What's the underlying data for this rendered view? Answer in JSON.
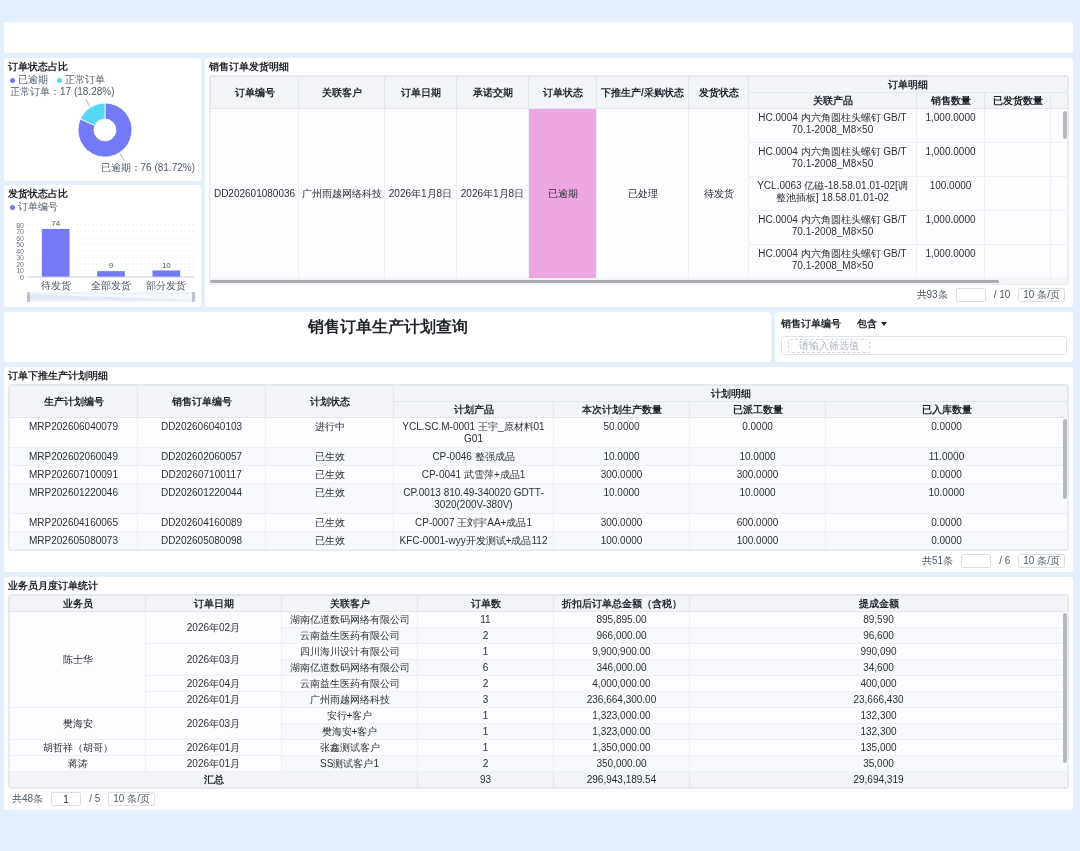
{
  "order_status_card": {
    "title": "订单状态占比",
    "legend": [
      {
        "color": "#7479f5"
      },
      {
        "color": "#55d7f6"
      }
    ],
    "chart_data": {
      "type": "donut",
      "categories": [
        "已逾期",
        "正常订单"
      ],
      "values": [
        76,
        17
      ],
      "value_labels": [
        "已逾期：76 (81.72%)",
        "正常订单：17 (18.28%)"
      ]
    }
  },
  "shipping_status_card": {
    "title": "发货状态占比",
    "chart_data": {
      "type": "bar",
      "categories": [
        "待发货",
        "全部发货",
        "部分发货"
      ],
      "series": [
        {
          "name": "订单编号",
          "color": "#7479f5",
          "values": [
            74,
            9,
            10
          ]
        }
      ],
      "ylim": [
        0,
        80
      ],
      "yticks": [
        0,
        10,
        20,
        30,
        40,
        50,
        60,
        70,
        80
      ],
      "grid": true,
      "data_labels": true
    }
  },
  "shipment_table": {
    "title": "销售订单发货明细",
    "columns": [
      "订单编号",
      "关联客户",
      "订单日期",
      "承诺交期",
      "订单状态",
      "下推生产/采购状态",
      "发货状态"
    ],
    "detail_header": "订单明细",
    "detail_columns": [
      "关联产品",
      "销售数量",
      "已发货数量"
    ],
    "rows": [
      {
        "order_no": "DD202601080036",
        "customer": "广州雨越网络科技",
        "order_date": "2026年1月8日",
        "promised_date": "2026年1月8日",
        "order_status": "已逾期",
        "overdue": true,
        "push_status": "已处理",
        "shipping_status": "待发货",
        "items": [
          {
            "product": "HC.0004 内六角圆柱头螺钉 GB/T 70.1-2008_M8×50",
            "quantity": "1,000.0000"
          },
          {
            "product": "HC.0004 内六角圆柱头螺钉 GB/T 70.1-2008_M8×50",
            "quantity": "1,000.0000"
          },
          {
            "product": "YCL.0063 亿磁-18.58.01.01-02[调整池插板] 18.58.01.01-02",
            "quantity": "100.0000"
          },
          {
            "product": "HC.0004 内六角圆柱头螺钉 GB/T 70.1-2008_M8×50",
            "quantity": "1,000.0000"
          },
          {
            "product": "HC.0004 内六角圆柱头螺钉 GB/T 70.1-2008_M8×50",
            "quantity": "1,000.0000"
          }
        ]
      }
    ],
    "pagination": {
      "total": "共93条",
      "pages": "/ 10",
      "page_size": "10 条/页"
    }
  },
  "page_title": "销售订单生产计划查询",
  "filter": {
    "label": "销售订单编号",
    "operator": "包含",
    "placeholder": "请输入筛选值"
  },
  "plan_table": {
    "title": "订单下推生产计划明细",
    "columns": [
      "生产计划编号",
      "销售订单编号",
      "计划状态"
    ],
    "detail_header": "计划明细",
    "detail_columns": [
      "计划产品",
      "本次计划生产数量",
      "已派工数量",
      "已入库数量"
    ],
    "rows": [
      [
        "MRP202606040079",
        "DD202606040103",
        "进行中",
        "YCL.SC.M-0001 王宇_原材料01 G01",
        "50.0000",
        "0.0000",
        "0.0000"
      ],
      [
        "MRP202602060049",
        "DD202602060057",
        "已生效",
        "CP-0046 整强成品",
        "10.0000",
        "10.0000",
        "11.0000"
      ],
      [
        "MRP202607100091",
        "DD202607100117",
        "已生效",
        "CP-0041 武雪萍+成品1",
        "300.0000",
        "300.0000",
        "0.0000"
      ],
      [
        "MRP202601220046",
        "DD202601220044",
        "已生效",
        "CP.0013 810.49-340020 GDTT-3020(200V-380V)",
        "10.0000",
        "10.0000",
        "10.0000"
      ],
      [
        "MRP202604160065",
        "DD202604160089",
        "已生效",
        "CP-0007 王刘宇AA+成品1",
        "300.0000",
        "600.0000",
        "0.0000"
      ],
      [
        "MRP202605080073",
        "DD202605080098",
        "已生效",
        "KFC-0001-wyy开发测试+成品112",
        "100.0000",
        "100.0000",
        "0.0000"
      ]
    ],
    "pagination": {
      "total": "共51条",
      "pages": "/ 6",
      "page_size": "10 条/页"
    }
  },
  "stats_table": {
    "title": "业务员月度订单统计",
    "columns": [
      "业务员",
      "订单日期",
      "关联客户",
      "订单数",
      "折扣后订单总金额（含税）",
      "提成金额"
    ],
    "groups": [
      {
        "salesperson": "陈士华",
        "months": [
          {
            "month": "2026年02月",
            "rows": [
              [
                "湖南亿道数码网络有限公司",
                "11",
                "895,895.00",
                "89,590"
              ],
              [
                "云南益生医药有限公司",
                "2",
                "966,000.00",
                "96,600"
              ]
            ]
          },
          {
            "month": "2026年03月",
            "rows": [
              [
                "四川海川设计有限公司",
                "1",
                "9,900,900.00",
                "990,090"
              ],
              [
                "湖南亿道数码网络有限公司",
                "6",
                "346,000.00",
                "34,600"
              ]
            ]
          },
          {
            "month": "2026年04月",
            "rows": [
              [
                "云南益生医药有限公司",
                "2",
                "4,000,000.00",
                "400,000"
              ]
            ]
          },
          {
            "month": "2026年01月",
            "rows": [
              [
                "广州雨越网络科技",
                "3",
                "236,664,300.00",
                "23,666,430"
              ]
            ]
          }
        ]
      },
      {
        "salesperson": "樊海安",
        "months": [
          {
            "month": "2026年03月",
            "rows": [
              [
                "安行+客户",
                "1",
                "1,323,000.00",
                "132,300"
              ],
              [
                "樊海安+客户",
                "1",
                "1,323,000.00",
                "132,300"
              ]
            ]
          }
        ]
      },
      {
        "salesperson": "胡哲祥（胡哥）",
        "months": [
          {
            "month": "2026年01月",
            "rows": [
              [
                "张鑫测试客户",
                "1",
                "1,350,000.00",
                "135,000"
              ]
            ]
          }
        ]
      },
      {
        "salesperson": "蒋涛",
        "months": [
          {
            "month": "2026年01月",
            "rows": [
              [
                "SS测试客户1",
                "2",
                "350,000.00",
                "35,000"
              ]
            ]
          }
        ]
      }
    ],
    "summary": {
      "label": "汇总",
      "orders": "93",
      "amount": "296,943,189.54",
      "commission": "29,694,319"
    },
    "pagination": {
      "total": "共48条",
      "page": "1",
      "pages": "/ 5",
      "page_size": "10 条/页"
    }
  }
}
